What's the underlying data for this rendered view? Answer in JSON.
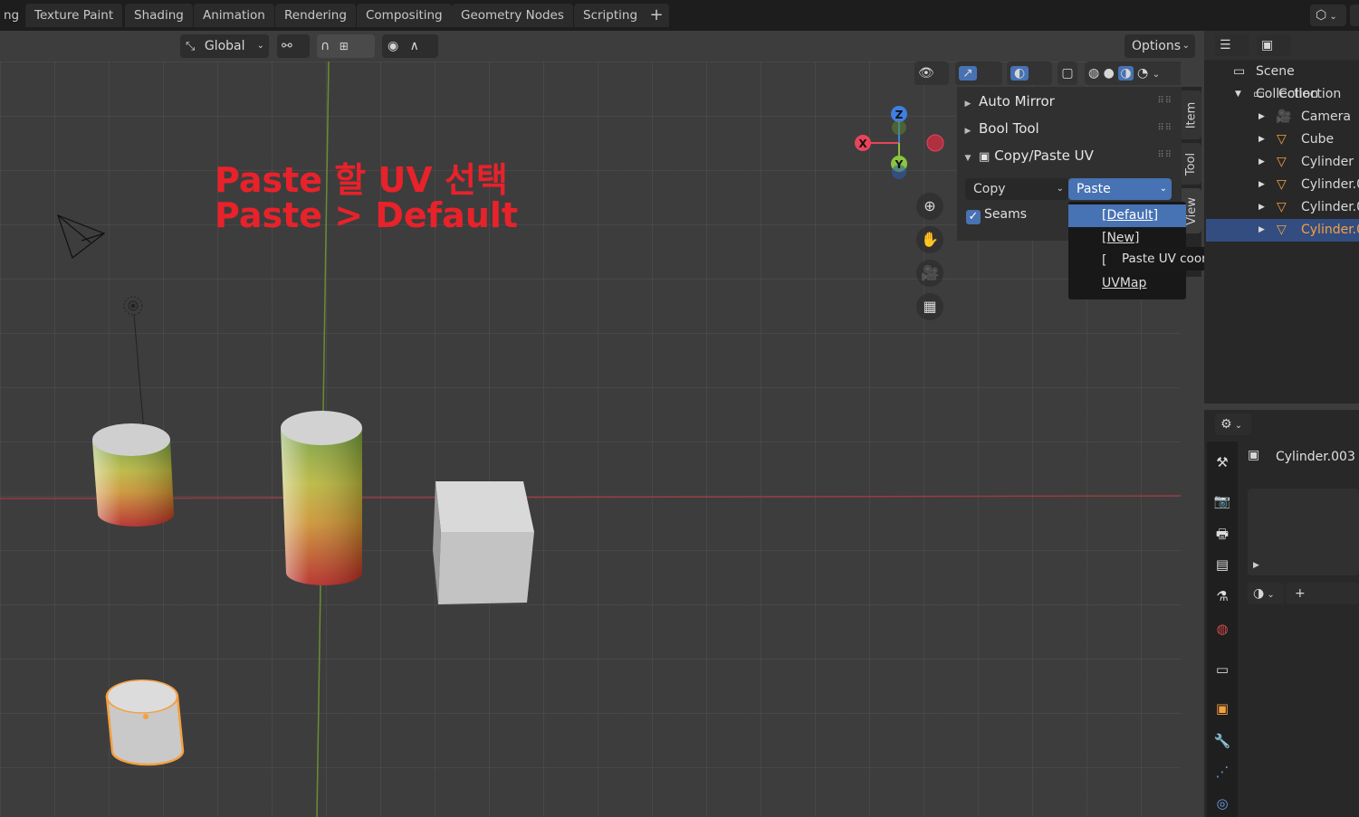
{
  "workspace_tabs": [
    "ng",
    "Texture Paint",
    "Shading",
    "Animation",
    "Rendering",
    "Compositing",
    "Geometry Nodes",
    "Scripting"
  ],
  "add_tab_icon": "plus-icon",
  "header": {
    "transform_orientation": "Global",
    "options_label": "Options"
  },
  "annotation": {
    "line1": "Paste 할 UV 선택",
    "line2": "Paste > Default"
  },
  "npanel": {
    "sections": [
      {
        "label": "Auto Mirror",
        "expanded": false
      },
      {
        "label": "Bool Tool",
        "expanded": false
      },
      {
        "label": "Copy/Paste UV",
        "expanded": true
      }
    ],
    "copy_select": "Copy",
    "paste_select": "Paste",
    "seams_label": "Seams",
    "seams_checked": true,
    "tabs": [
      "Item",
      "Tool",
      "View"
    ]
  },
  "paste_menu": {
    "items": [
      "[Default]",
      "[New]",
      "[",
      "UVMap"
    ],
    "highlighted_index": 0
  },
  "tooltip": "Paste UV coordinate (Among Objects).",
  "gizmo": {
    "z": "Z",
    "x": "X",
    "y": "Y"
  },
  "outliner": {
    "rows": [
      {
        "label": "Scene Collection",
        "icon": "scene-collection-icon",
        "indent": 0
      },
      {
        "label": "Collection",
        "icon": "collection-icon",
        "indent": 1
      },
      {
        "label": "Camera",
        "icon": "camera-object-icon",
        "indent": 2
      },
      {
        "label": "Cube",
        "icon": "mesh-object-icon",
        "indent": 2
      },
      {
        "label": "Cylinder",
        "icon": "mesh-object-icon",
        "indent": 2
      },
      {
        "label": "Cylinder.0",
        "icon": "mesh-object-icon",
        "indent": 2
      },
      {
        "label": "Cylinder.0",
        "icon": "mesh-object-icon",
        "indent": 2
      },
      {
        "label": "Cylinder.0",
        "icon": "mesh-object-icon",
        "indent": 2,
        "selected": true
      }
    ]
  },
  "properties": {
    "object_name": "Cylinder.003"
  },
  "colors": {
    "accent_blue": "#4772b3",
    "selection_orange": "#f5a041",
    "annotation_red": "#e8222a",
    "axis_x": "#e8445a",
    "axis_y": "#8bc53f",
    "axis_z": "#3f7fe0"
  }
}
